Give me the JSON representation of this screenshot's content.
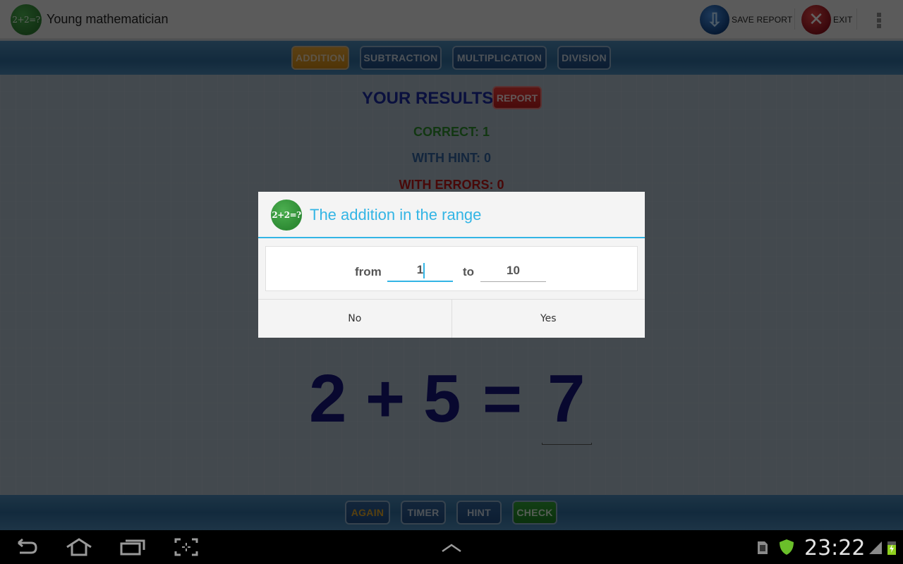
{
  "app": {
    "title": "Young mathematician",
    "logo_text": "2+2=?",
    "actions": {
      "save_report": "SAVE REPORT",
      "exit": "EXIT"
    }
  },
  "operations": [
    {
      "label": "ADDITION",
      "active": true
    },
    {
      "label": "SUBTRACTION",
      "active": false
    },
    {
      "label": "MULTIPLICATION",
      "active": false
    },
    {
      "label": "DIVISION",
      "active": false
    }
  ],
  "results": {
    "title": "YOUR RESULTS",
    "report_label": "REPORT",
    "correct": "CORRECT: 1",
    "with_hint": "WITH HINT: 0",
    "with_errors": "WITH ERRORS: 0"
  },
  "equation": {
    "a": "2",
    "op": "+",
    "b": "5",
    "eq": "=",
    "answer": "7"
  },
  "bottom_buttons": {
    "again": "AGAIN",
    "timer": "TIMER",
    "hint": "HINT",
    "check": "CHECK"
  },
  "dialog": {
    "logo_text": "2+2=?",
    "title": "The addition in the range",
    "from_label": "from",
    "from_value": "1",
    "to_label": "to",
    "to_value": "10",
    "no_label": "No",
    "yes_label": "Yes"
  },
  "status": {
    "time": "23:22",
    "accent": "#33b5e5"
  }
}
